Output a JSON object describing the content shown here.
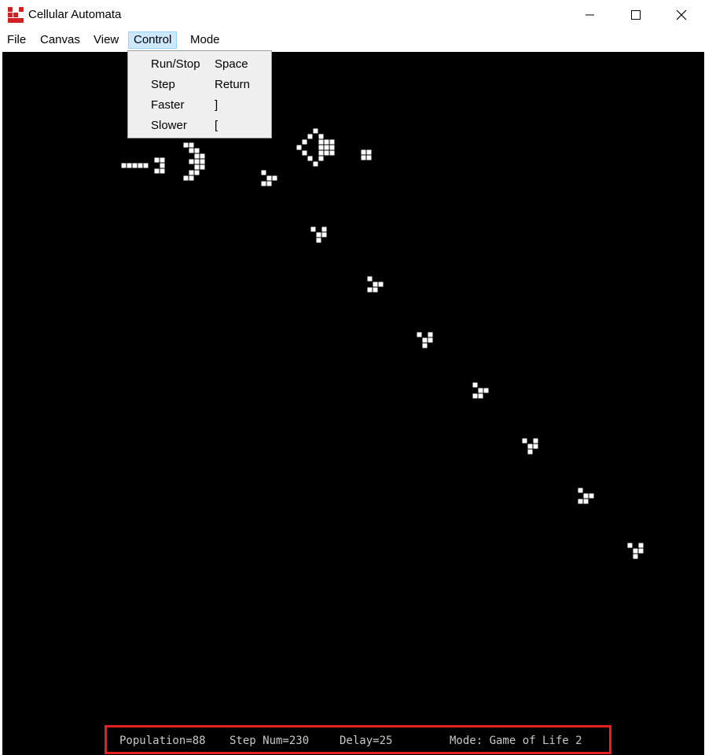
{
  "window": {
    "title": "Cellular Automata",
    "controls": [
      "minimize",
      "maximize",
      "close"
    ]
  },
  "menubar": {
    "items": [
      "File",
      "Canvas",
      "View",
      "Control",
      "Mode"
    ],
    "active": "Control"
  },
  "control_menu": {
    "items": [
      {
        "label": "Run/Stop",
        "shortcut": "Space"
      },
      {
        "label": "Step",
        "shortcut": "Return"
      },
      {
        "label": "Faster",
        "shortcut": "]"
      },
      {
        "label": "Slower",
        "shortcut": "["
      }
    ]
  },
  "status": {
    "population": "Population=88",
    "step_num": "Step Num=230",
    "delay": "Delay=25",
    "mode": "Mode: Game of Life 2"
  },
  "colors": {
    "canvas_bg": "#000000",
    "live_cell": "#ffffff",
    "menu_highlight": "#cce8ff",
    "status_outline": "#e52020"
  }
}
